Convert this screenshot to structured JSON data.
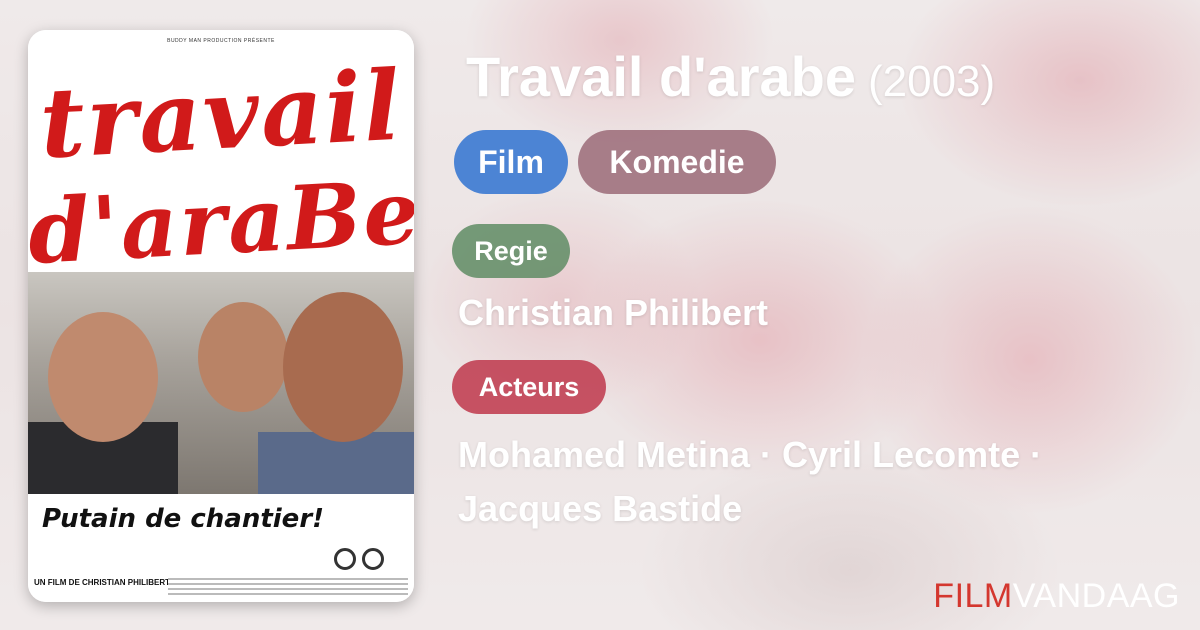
{
  "movie": {
    "title": "Travail d'arabe",
    "year": "(2003)"
  },
  "tags": {
    "type": "Film",
    "genre": "Komedie"
  },
  "sections": {
    "director_label": "Regie",
    "director": "Christian Philibert",
    "actors_label": "Acteurs",
    "actors": "Mohamed Metina · Cyril Lecomte · Jacques Bastide"
  },
  "poster": {
    "credit_top": "BUDDY MAN PRODUCTION PRÉSENTE",
    "title_line1": "travail",
    "title_line2": "d'araBe",
    "tagline": "Putain de chantier!",
    "director_credit": "UN FILM DE CHRISTIAN PHILIBERT"
  },
  "brand": {
    "part1": "FILM",
    "part2": "VANDAAG"
  },
  "colors": {
    "film_pill": "#4c84d4",
    "genre_pill": "#8c5564",
    "regie_label": "#5f8c64",
    "acteurs_label": "#be374b",
    "brand_red": "#d4372f"
  }
}
